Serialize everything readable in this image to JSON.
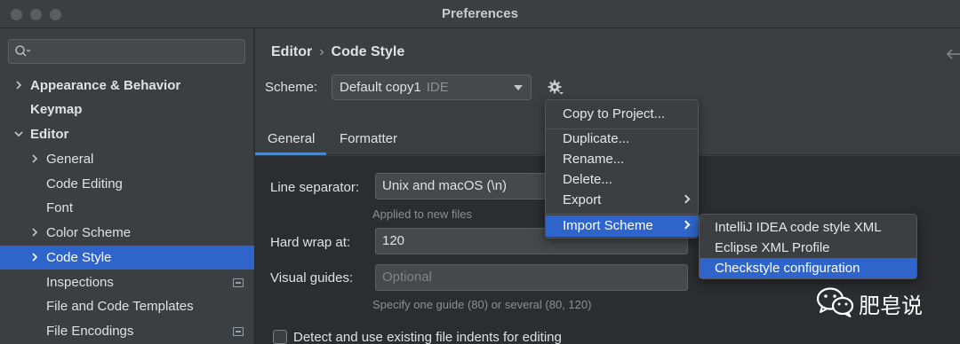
{
  "window": {
    "title": "Preferences",
    "traffic_lights": [
      "close",
      "minimize",
      "zoom"
    ]
  },
  "sidebar": {
    "search_placeholder": "",
    "items": [
      {
        "label": "Appearance & Behavior",
        "bold": true,
        "expander": "collapsed"
      },
      {
        "label": "Keymap",
        "bold": true,
        "expander": "none"
      },
      {
        "label": "Editor",
        "bold": true,
        "expander": "expanded"
      },
      {
        "label": "General",
        "bold": false,
        "expander": "collapsed"
      },
      {
        "label": "Code Editing",
        "bold": false,
        "expander": "none"
      },
      {
        "label": "Font",
        "bold": false,
        "expander": "none"
      },
      {
        "label": "Color Scheme",
        "bold": false,
        "expander": "collapsed"
      },
      {
        "label": "Code Style",
        "bold": false,
        "expander": "collapsed",
        "selected": true
      },
      {
        "label": "Inspections",
        "bold": false,
        "expander": "none",
        "badge": true
      },
      {
        "label": "File and Code Templates",
        "bold": false,
        "expander": "none"
      },
      {
        "label": "File Encodings",
        "bold": false,
        "expander": "none",
        "badge": true
      }
    ]
  },
  "breadcrumb": {
    "parent": "Editor",
    "separator": "›",
    "current": "Code Style"
  },
  "scheme": {
    "label": "Scheme:",
    "value": "Default copy1",
    "hint": "IDE"
  },
  "tabs": [
    {
      "label": "General",
      "active": true
    },
    {
      "label": "Formatter",
      "active": false
    }
  ],
  "form": {
    "line_separator_label": "Line separator:",
    "line_separator_value": "Unix and macOS (\\n)",
    "line_separator_note": "Applied to new files",
    "hard_wrap_label": "Hard wrap at:",
    "hard_wrap_value": "120",
    "visual_guides_label": "Visual guides:",
    "visual_guides_placeholder": "Optional",
    "visual_guides_note": "Specify one guide (80) or several (80, 120)",
    "detect_indents_label": "Detect and use existing file indents for editing"
  },
  "menu": {
    "items": [
      {
        "label": "Copy to Project..."
      },
      {
        "label": "Duplicate..."
      },
      {
        "label": "Rename..."
      },
      {
        "label": "Delete..."
      },
      {
        "label": "Export",
        "submenu": true
      },
      {
        "label": "Import Scheme",
        "submenu": true,
        "highlighted": true
      }
    ]
  },
  "submenu": {
    "items": [
      {
        "label": "IntelliJ IDEA code style XML"
      },
      {
        "label": "Eclipse XML Profile"
      },
      {
        "label": "Checkstyle configuration",
        "highlighted": true
      }
    ]
  },
  "watermark": {
    "text": "肥皂说"
  },
  "colors": {
    "selection": "#2f65ca",
    "panel": "#3c3f41",
    "content": "#2b2d30",
    "tab_underline": "#4a88c7"
  }
}
